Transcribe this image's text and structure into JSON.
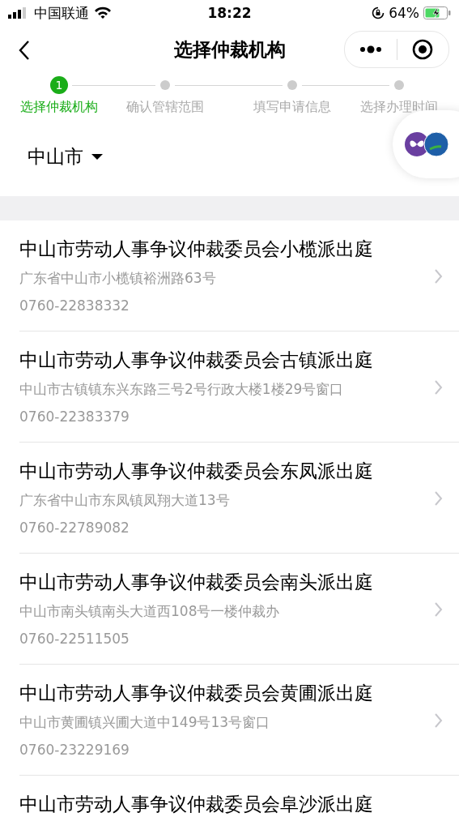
{
  "status_bar": {
    "carrier": "中国联通",
    "time": "18:22",
    "battery": "64%"
  },
  "nav": {
    "title": "选择仲裁机构"
  },
  "steps": [
    {
      "label": "选择仲裁机构",
      "number": "1",
      "selected": true
    },
    {
      "label": "确认管辖范围",
      "selected": false
    },
    {
      "label": "填写申请信息",
      "selected": false
    },
    {
      "label": "选择办理时间",
      "selected": false
    }
  ],
  "city": {
    "label": "中山市"
  },
  "organizations": [
    {
      "name": "中山市劳动人事争议仲裁委员会小榄派出庭",
      "address": "广东省中山市小榄镇裕洲路63号",
      "phone": "0760-22838332"
    },
    {
      "name": "中山市劳动人事争议仲裁委员会古镇派出庭",
      "address": "中山市古镇镇东兴东路三号2号行政大楼1楼29号窗口",
      "phone": "0760-22383379"
    },
    {
      "name": "中山市劳动人事争议仲裁委员会东凤派出庭",
      "address": "广东省中山市东凤镇凤翔大道13号",
      "phone": "0760-22789082"
    },
    {
      "name": "中山市劳动人事争议仲裁委员会南头派出庭",
      "address": "中山市南头镇南头大道西108号一楼仲裁办",
      "phone": "0760-22511505"
    },
    {
      "name": "中山市劳动人事争议仲裁委员会黄圃派出庭",
      "address": "中山市黄圃镇兴圃大道中149号13号窗口",
      "phone": "0760-23229169"
    },
    {
      "name": "中山市劳动人事争议仲裁委员会阜沙派出庭"
    }
  ]
}
